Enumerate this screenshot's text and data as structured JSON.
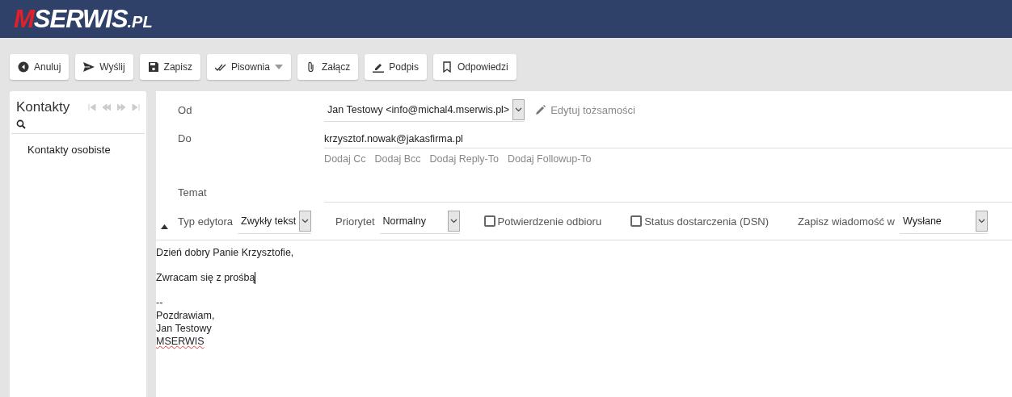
{
  "header": {
    "logo": {
      "mark": "M",
      "name": "SERWIS",
      "suffix": ".PL"
    }
  },
  "toolbar": [
    {
      "kind": "cancel",
      "label": "Anuluj"
    },
    {
      "kind": "send",
      "label": "Wyślij"
    },
    {
      "kind": "save",
      "label": "Zapisz"
    },
    {
      "kind": "spell",
      "label": "Pisownia",
      "dropdown": true
    },
    {
      "kind": "attach",
      "label": "Załącz"
    },
    {
      "kind": "signature",
      "label": "Podpis"
    },
    {
      "kind": "responses",
      "label": "Odpowiedzi"
    }
  ],
  "contacts": {
    "title": "Kontakty",
    "items": [
      {
        "label": "Kontakty osobiste"
      }
    ]
  },
  "compose": {
    "from": {
      "label": "Od",
      "value": "Jan Testowy <info@michal4.mserwis.pl>",
      "edit_link": "Edytuj tożsamości"
    },
    "to": {
      "label": "Do",
      "value": "krzysztof.nowak@jakasfirma.pl"
    },
    "add_links": [
      "Dodaj Cc",
      "Dodaj Bcc",
      "Dodaj Reply-To",
      "Dodaj Followup-To"
    ],
    "subject": {
      "label": "Temat"
    },
    "options": [
      {
        "kind": "select",
        "label": "Typ edytora",
        "value": "Zwykły tekst"
      },
      {
        "kind": "select",
        "label": "Priorytet",
        "value": "Normalny"
      },
      {
        "kind": "checkbox",
        "label": "Potwierdzenie odbioru",
        "checked": false
      },
      {
        "kind": "checkbox",
        "label": "Status dostarczenia (DSN)",
        "checked": false
      },
      {
        "kind": "select",
        "label": "Zapisz wiadomość w",
        "value": "Wysłane"
      }
    ],
    "body": [
      [
        {
          "text": "Dzień dobry Panie Krzysztofie,",
          "misspelled": false,
          "cursor": false
        }
      ],
      [
        {
          "text": "Zwracam się z prośbą",
          "misspelled": false,
          "cursor": true
        }
      ],
      [
        {
          "text": "--",
          "misspelled": false,
          "cursor": false
        },
        {
          "text": "Pozdrawiam,",
          "misspelled": false,
          "cursor": false
        },
        {
          "text": "Jan Testowy",
          "misspelled": false,
          "cursor": false
        },
        {
          "text": "MSERWIS",
          "misspelled": true,
          "cursor": false
        }
      ]
    ]
  }
}
